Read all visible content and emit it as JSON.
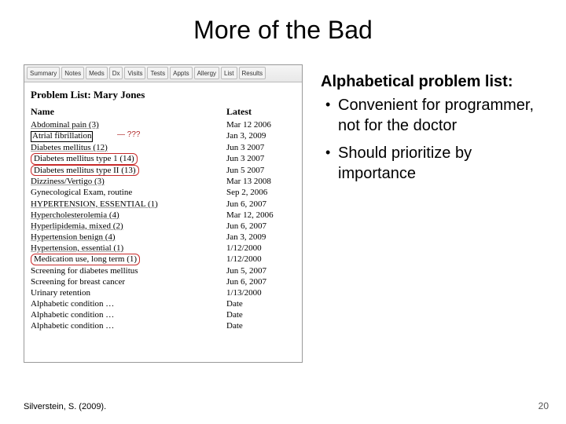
{
  "title": "More of the Bad",
  "toolbar": [
    "Summary",
    "Notes",
    "Meds",
    "Dx",
    "Visits",
    "Tests",
    "Appts",
    "Allergy",
    "List",
    "Results"
  ],
  "problem_list": {
    "heading": "Problem List:  Mary Jones",
    "columns": [
      "Name",
      "Latest"
    ],
    "rows": [
      {
        "name": "Abdominal pain (3)",
        "latest": "Mar 12 2006",
        "style": "underline"
      },
      {
        "name": "Atrial fibrillation",
        "latest": "Jan 3, 2009",
        "style": "box-black",
        "annotation": "— ???"
      },
      {
        "name": "Diabetes mellitus (12)",
        "latest": "Jun 3 2007",
        "style": "underline"
      },
      {
        "name": "Diabetes mellitus type 1 (14)",
        "latest": "Jun 3 2007",
        "style": "box-red"
      },
      {
        "name": "Diabetes mellitus type II (13)",
        "latest": "Jun 5 2007",
        "style": "box-red"
      },
      {
        "name": "Dizziness/Vertigo (3)",
        "latest": "Mar 13 2008",
        "style": "underline"
      },
      {
        "name": "Gynecological Exam, routine",
        "latest": "Sep 2, 2006"
      },
      {
        "name": "HYPERTENSION, ESSENTIAL (1)",
        "latest": "Jun 6, 2007",
        "style": "underline"
      },
      {
        "name": "Hypercholesterolemia (4)",
        "latest": "Mar 12, 2006",
        "style": "underline"
      },
      {
        "name": "Hyperlipidemia, mixed (2)",
        "latest": "Jun 6, 2007",
        "style": "underline"
      },
      {
        "name": "Hypertension benign (4)",
        "latest": "Jan 3, 2009",
        "style": "underline"
      },
      {
        "name": "Hypertension, essential (1)",
        "latest": "1/12/2000",
        "style": "underline"
      },
      {
        "name": "Medication use, long term (1)",
        "latest": "1/12/2000",
        "style": "box-red"
      },
      {
        "name": "Screening for diabetes mellitus",
        "latest": "Jun 5, 2007"
      },
      {
        "name": "Screening for breast cancer",
        "latest": "Jun 6, 2007"
      },
      {
        "name": "Urinary retention",
        "latest": "1/13/2000"
      },
      {
        "name": "Alphabetic condition …",
        "latest": "Date"
      },
      {
        "name": "Alphabetic condition …",
        "latest": "Date"
      },
      {
        "name": "Alphabetic condition …",
        "latest": "Date"
      }
    ]
  },
  "commentary": {
    "heading": "Alphabetical problem list:",
    "bullets": [
      "Convenient for programmer, not for the doctor",
      "Should prioritize by importance"
    ]
  },
  "citation": "Silverstein, S.  (2009).",
  "page_number": "20"
}
